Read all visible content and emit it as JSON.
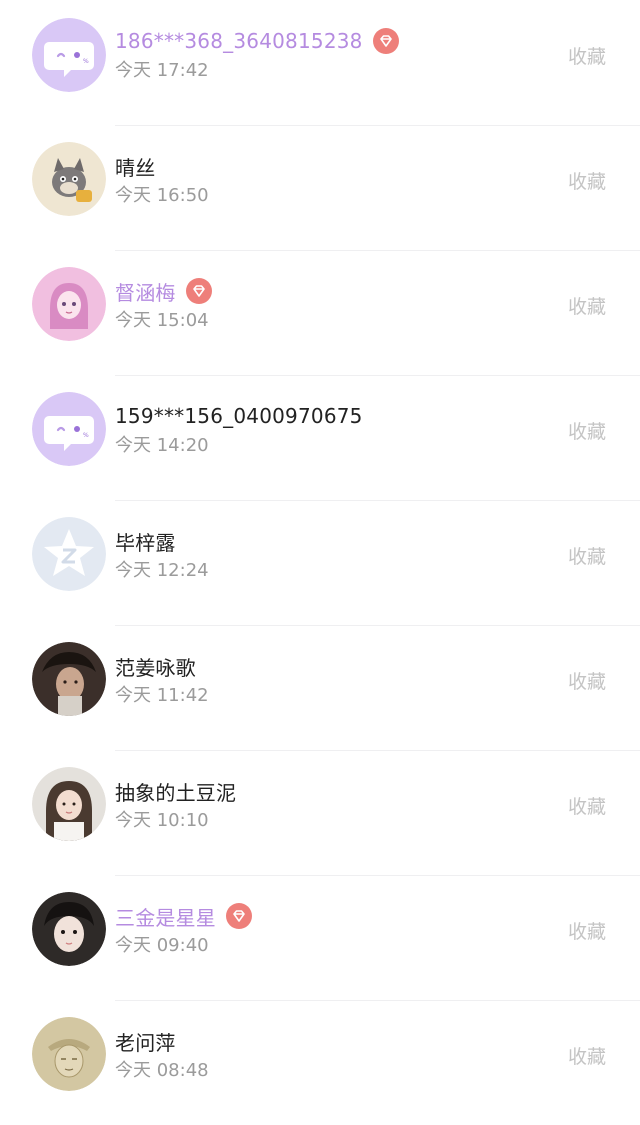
{
  "colors": {
    "vip_name": "#b58be0",
    "vip_badge": "#ee7f7a",
    "time": "#9b9b9b",
    "favorite": "#c4c4c4",
    "name": "#222222",
    "divider": "#efeff1"
  },
  "messages": [
    {
      "name": "186***368_3640815238",
      "time": "今天 17:42",
      "vip": true,
      "avatar": "chat-bubble-avatar",
      "favorite_label": "收藏"
    },
    {
      "name": "晴丝",
      "time": "今天 16:50",
      "vip": false,
      "avatar": "cartoon-cat-avatar",
      "favorite_label": "收藏"
    },
    {
      "name": "督涵梅",
      "time": "今天 15:04",
      "vip": true,
      "avatar": "anime-girl-avatar",
      "favorite_label": "收藏"
    },
    {
      "name": "159***156_0400970675",
      "time": "今天 14:20",
      "vip": false,
      "avatar": "chat-bubble-avatar",
      "favorite_label": "收藏"
    },
    {
      "name": "毕梓露",
      "time": "今天 12:24",
      "vip": false,
      "avatar": "default-star-avatar",
      "favorite_label": "收藏"
    },
    {
      "name": "范姜咏歌",
      "time": "今天 11:42",
      "vip": false,
      "avatar": "photo-man-avatar",
      "favorite_label": "收藏"
    },
    {
      "name": "抽象的土豆泥",
      "time": "今天 10:10",
      "vip": false,
      "avatar": "photo-woman-avatar",
      "favorite_label": "收藏"
    },
    {
      "name": "三金是星星",
      "time": "今天 09:40",
      "vip": true,
      "avatar": "photo-boy-avatar",
      "favorite_label": "收藏"
    },
    {
      "name": "老问萍",
      "time": "今天 08:48",
      "vip": false,
      "avatar": "sketch-avatar",
      "favorite_label": "收藏"
    }
  ]
}
